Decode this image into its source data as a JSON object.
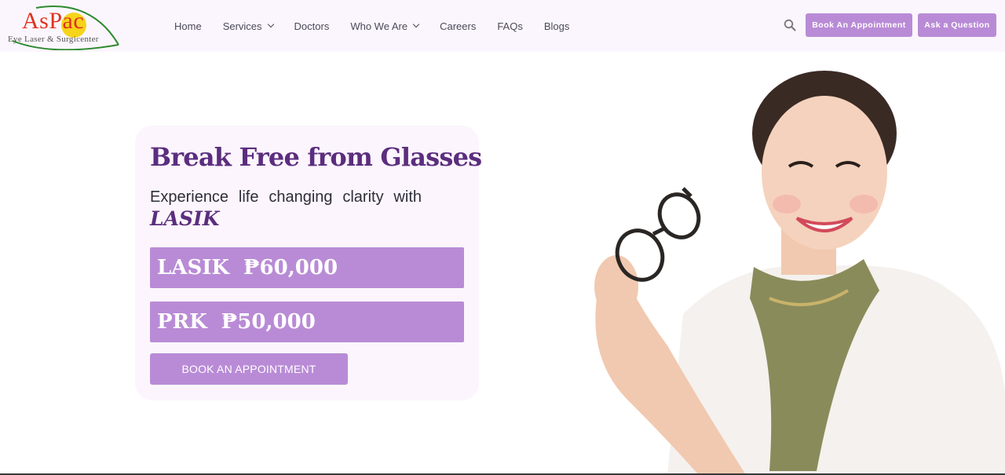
{
  "brand": {
    "name": "AsPac",
    "tagline": "Eye Laser & Surgicenter",
    "colors": {
      "accent": "#b98bd6",
      "headline": "#5b2d7e",
      "logo_red": "#e0321e",
      "logo_green": "#2e8b2e",
      "logo_sun": "#f5d000"
    }
  },
  "nav": {
    "items": [
      {
        "label": "Home",
        "dropdown": false
      },
      {
        "label": "Services",
        "dropdown": true
      },
      {
        "label": "Doctors",
        "dropdown": false
      },
      {
        "label": "Who We Are",
        "dropdown": true
      },
      {
        "label": "Careers",
        "dropdown": false
      },
      {
        "label": "FAQs",
        "dropdown": false
      },
      {
        "label": "Blogs",
        "dropdown": false
      }
    ],
    "search_icon": "search-icon",
    "book_button": "Book An Appointment",
    "ask_button": "Ask a Question"
  },
  "hero": {
    "headline": "Break Free from Glasses",
    "subline": "Experience life changing clarity with",
    "subline_emphasis": "LASIK",
    "prices": [
      {
        "name": "LASIK",
        "price": "₱60,000"
      },
      {
        "name": "PRK",
        "price": "₱50,000"
      }
    ],
    "cta_label": "BOOK AN APPOINTMENT",
    "image": "smiling woman holding eyeglasses"
  }
}
